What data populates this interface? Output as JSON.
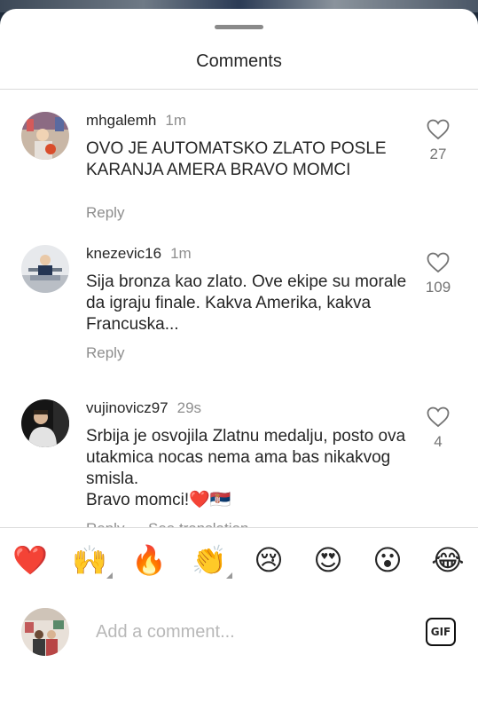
{
  "header": {
    "title": "Comments"
  },
  "comments": [
    {
      "username": "mhgalemh",
      "time": "1m",
      "text": "OVO JE AUTOMATSKO ZLATO POSLE KARANJA AMERA BRAVO MOMCI",
      "reply_label": "Reply",
      "likes": "27"
    },
    {
      "username": "knezevic16",
      "time": "1m",
      "text": "Sija bronza kao zlato. Ove ekipe su morale da igraju finale. Kakva Amerika, kakva Francuska...",
      "reply_label": "Reply",
      "likes": "109"
    },
    {
      "username": "vujinovicz97",
      "time": "29s",
      "text": "Srbija je osvojila Zlatnu medalju, posto ova utakmica nocas nema ama bas nikakvog smisla.\nBravo momci!❤️🇷🇸",
      "reply_label": "Reply",
      "see_translation": "See translation",
      "likes": "4"
    }
  ],
  "emoji_bar": [
    "❤️",
    "🙌",
    "🔥",
    "👏",
    "😢",
    "😍",
    "😮",
    "😂"
  ],
  "composer": {
    "placeholder": "Add a comment...",
    "gif_label": "GIF"
  },
  "icons": {
    "like": "heart-outline-icon",
    "gif": "gif-icon"
  },
  "colors": {
    "text": "#262626",
    "secondary": "#8e8e8e",
    "divider": "#dbdbdb"
  }
}
